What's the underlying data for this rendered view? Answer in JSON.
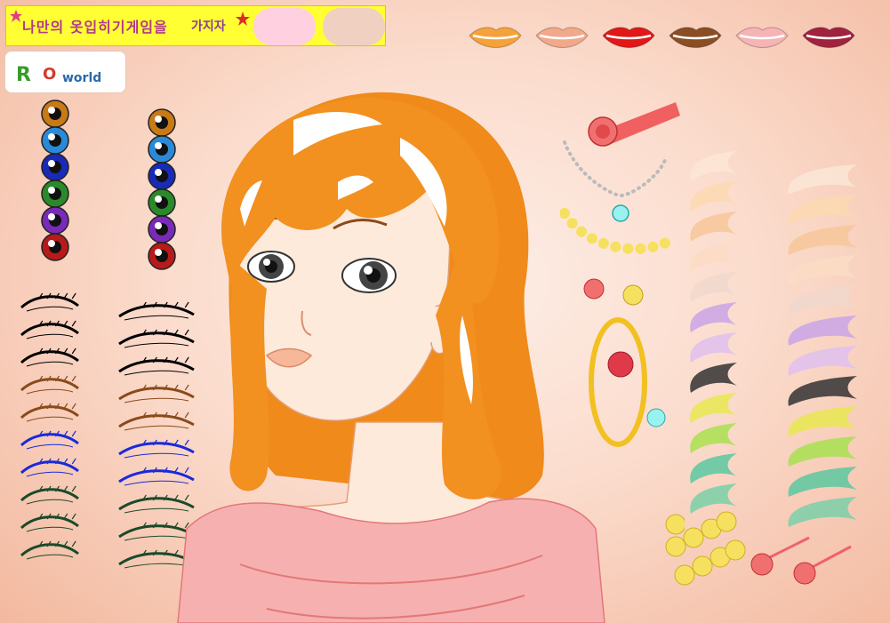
{
  "banner": {
    "text_left": "나만의 옷입히기게임을",
    "text_right": "가지자"
  },
  "logo": {
    "brand_r": "R",
    "brand_o": "O",
    "brand_world": "world"
  },
  "palette": {
    "lip_colors": [
      "#f5a23a",
      "#f2a88a",
      "#e01818",
      "#8a4e24",
      "#f6b4b4",
      "#a0233e"
    ],
    "eye_colors": [
      "#c87a16",
      "#2a8ad8",
      "#1a2ab8",
      "#2a8a2a",
      "#7a2ab8",
      "#b81a1a"
    ],
    "liner_colors": [
      "#000000",
      "#000000",
      "#000000",
      "#8a4a1a",
      "#8a4a1a",
      "#1a2ad8",
      "#1a2ad8",
      "#1a4a2a",
      "#1a4a2a",
      "#1a4a2a"
    ],
    "shadow_colors": [
      "#fbe6d6",
      "#fcd9b0",
      "#f7c79a",
      "#fbdcc4",
      "#f0d8cc",
      "#c9a4e8",
      "#e0c0f0",
      "#333333",
      "#e8e850",
      "#a8e050",
      "#5ac8a0",
      "#7ad0a8"
    ],
    "hair_color": "#f08a1a",
    "skin_color": "#fdeadb"
  },
  "character": {
    "name": "doll-face"
  }
}
